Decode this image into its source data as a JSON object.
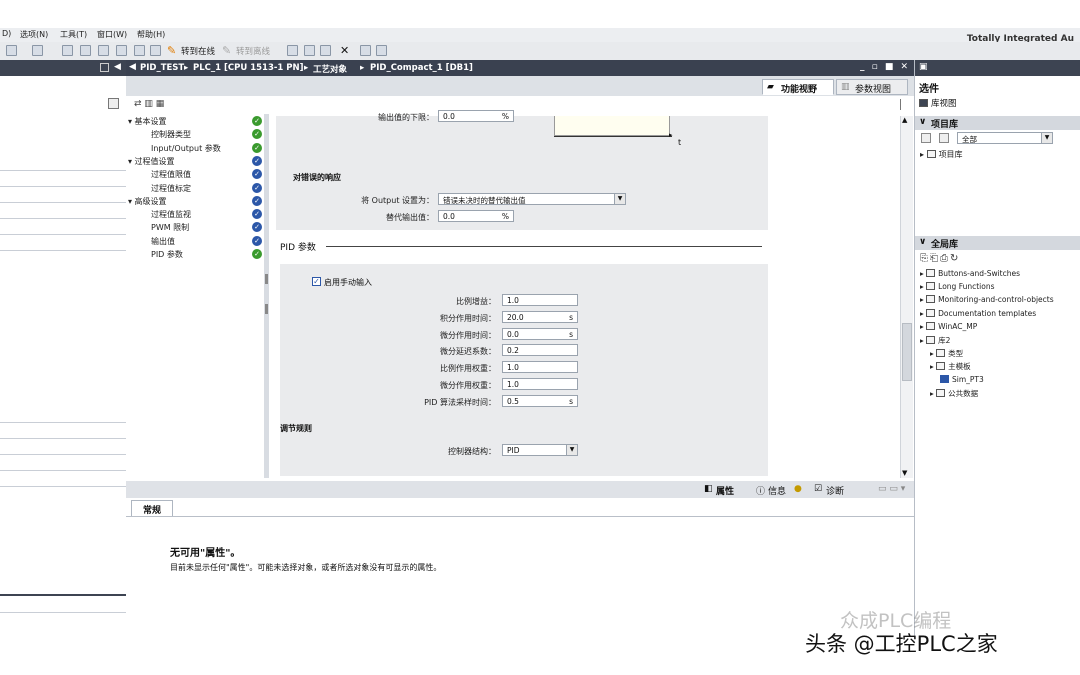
{
  "menu": {
    "item0": "D)",
    "item1": "选项(N)",
    "item2": "工具(T)",
    "item3": "窗口(W)",
    "item4": "帮助(H)"
  },
  "toolbar": {
    "go_online": "转到在线",
    "go_offline": "转到离线"
  },
  "app_brand": "Totally Integrated Au",
  "editor": {
    "breadcrumb": [
      "PID_TEST",
      "PLC_1 [CPU 1513-1 PN]",
      "工艺对象",
      "PID_Compact_1 [DB1]"
    ],
    "tabs": {
      "function_view": "功能视野",
      "param_view": "参数视图"
    },
    "nav": [
      {
        "label": "▾ 基本设置",
        "status": "ok"
      },
      {
        "label": "控制器类型",
        "status": "ok"
      },
      {
        "label": "Input/Output 参数",
        "status": "ok"
      },
      {
        "label": "▾ 过程值设置",
        "status": "info"
      },
      {
        "label": "过程值限值",
        "status": "info"
      },
      {
        "label": "过程值标定",
        "status": "info"
      },
      {
        "label": "▾ 高级设置",
        "status": "info"
      },
      {
        "label": "过程值监视",
        "status": "info"
      },
      {
        "label": "PWM 限制",
        "status": "info"
      },
      {
        "label": "输出值",
        "status": "info"
      },
      {
        "label": "PID 参数",
        "status": "ok"
      }
    ],
    "top_field": {
      "label": "输出值的下限：",
      "value": "0.0",
      "unit": "%"
    },
    "axis_t": "t",
    "error_section": {
      "title": "对错误的响应",
      "output_label": "将 Output 设置为：",
      "output_value": "错误未决时的替代输出值",
      "sub_label": "替代输出值：",
      "sub_value": "0.0",
      "sub_unit": "%"
    },
    "pid_section": {
      "title": "PID 参数",
      "manual_entry": "启用手动输入",
      "manual_checked": true,
      "params": [
        {
          "label": "比例增益：",
          "value": "1.0",
          "unit": ""
        },
        {
          "label": "积分作用时间：",
          "value": "20.0",
          "unit": "s"
        },
        {
          "label": "微分作用时间：",
          "value": "0.0",
          "unit": "s"
        },
        {
          "label": "微分延迟系数：",
          "value": "0.2",
          "unit": ""
        },
        {
          "label": "比例作用权重：",
          "value": "1.0",
          "unit": ""
        },
        {
          "label": "微分作用权重：",
          "value": "1.0",
          "unit": ""
        },
        {
          "label": "PID 算法采样时间：",
          "value": "0.5",
          "unit": "s"
        }
      ],
      "rule_title": "调节规则",
      "structure_label": "控制器结构：",
      "structure_value": "PID"
    }
  },
  "inspector": {
    "tab_props": "属性",
    "tab_info": "信息",
    "tab_diag": "诊断",
    "general_tab": "常规",
    "heading": "无可用\"属性\"。",
    "message": "目前未显示任何\"属性\"。可能未选择对象，或者所选对象没有可显示的属性。"
  },
  "right": {
    "options": "选件",
    "lib_view": "库视图",
    "project_lib": "项目库",
    "filter_value": "全部",
    "project_lib_node": "项目库",
    "global_lib": "全局库",
    "libs": [
      {
        "label": "Buttons-and-Switches",
        "indent": 0
      },
      {
        "label": "Long Functions",
        "indent": 0
      },
      {
        "label": "Monitoring-and-control-objects",
        "indent": 0
      },
      {
        "label": "Documentation templates",
        "indent": 0
      },
      {
        "label": "WinAC_MP",
        "indent": 0
      },
      {
        "label": "库2",
        "indent": 0
      },
      {
        "label": "类型",
        "indent": 1
      },
      {
        "label": "主模板",
        "indent": 1
      },
      {
        "label": "Sim_PT3",
        "indent": 2
      },
      {
        "label": "公共数据",
        "indent": 1
      }
    ]
  },
  "watermark": {
    "faint": "众成PLC编程",
    "main": "头条 @工控PLC之家"
  }
}
